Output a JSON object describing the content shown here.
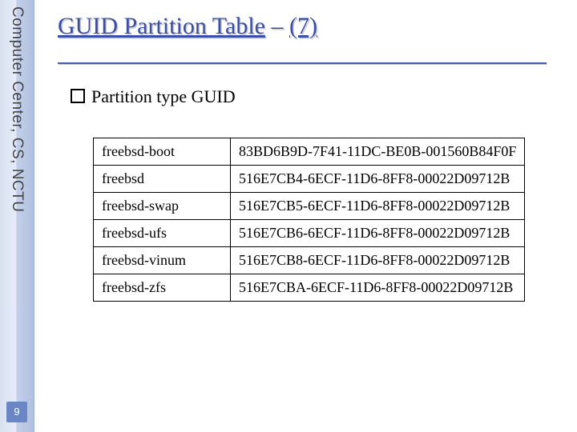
{
  "sidebar": {
    "text": "Computer Center, CS, NCTU",
    "page_number": "9"
  },
  "title": {
    "main": "GUID Partition Table",
    "separator": " – ",
    "suffix": "(7)"
  },
  "bullet": {
    "text": "Partition type GUID"
  },
  "table": {
    "rows": [
      {
        "name": "freebsd-boot",
        "guid": "83BD6B9D-7F41-11DC-BE0B-001560B84F0F"
      },
      {
        "name": "freebsd",
        "guid": "516E7CB4-6ECF-11D6-8FF8-00022D09712B"
      },
      {
        "name": "freebsd-swap",
        "guid": "516E7CB5-6ECF-11D6-8FF8-00022D09712B"
      },
      {
        "name": "freebsd-ufs",
        "guid": "516E7CB6-6ECF-11D6-8FF8-00022D09712B"
      },
      {
        "name": "freebsd-vinum",
        "guid": "516E7CB8-6ECF-11D6-8FF8-00022D09712B"
      },
      {
        "name": "freebsd-zfs",
        "guid": "516E7CBA-6ECF-11D6-8FF8-00022D09712B"
      }
    ]
  }
}
